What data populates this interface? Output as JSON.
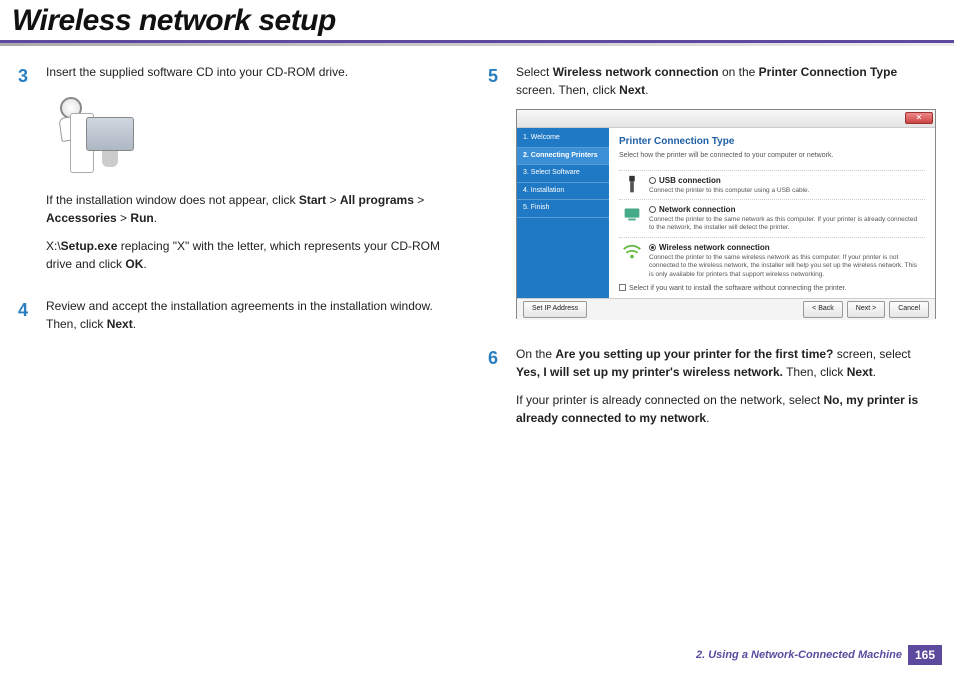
{
  "header": {
    "title": "Wireless network setup"
  },
  "left": {
    "step3": {
      "num": "3",
      "p1": "Insert the supplied software CD into your CD-ROM drive.",
      "p2a": "If the installation window does not appear, click ",
      "start": "Start",
      "gt1": " > ",
      "allprograms": "All programs",
      "gt2": " > ",
      "accessories": "Accessories",
      "gt3": " > ",
      "run": "Run",
      "p2b": ".",
      "p3a": " X:\\",
      "setup": "Setup.exe",
      "p3b": " replacing \"X\" with the letter, which represents your CD-ROM drive and click ",
      "ok": "OK",
      "p3c": "."
    },
    "step4": {
      "num": "4",
      "p1a": "Review and accept the installation agreements in the installation window. Then, click ",
      "next": "Next",
      "p1b": "."
    }
  },
  "right": {
    "step5": {
      "num": "5",
      "p1a": "Select ",
      "wnc": "Wireless network connection",
      "p1b": " on the ",
      "pct": "Printer Connection Type",
      "p1c": " screen. Then, click ",
      "next": "Next",
      "p1d": "."
    },
    "step6": {
      "num": "6",
      "p1a": "On the ",
      "q": "Are you setting up your printer for the first time?",
      "p1b": " screen, select ",
      "yes": "Yes, I will set up my printer's wireless network.",
      "p1c": " Then, click ",
      "next": "Next",
      "p1d": ".",
      "p2a": "If your printer is already connected on the network, select ",
      "no": "No, my printer is already connected to my network",
      "p2b": "."
    }
  },
  "wizard": {
    "sidebar": [
      "1. Welcome",
      "2. Connecting Printers",
      "3. Select Software",
      "4. Installation",
      "5. Finish"
    ],
    "heading": "Printer Connection Type",
    "sub": "Select how the printer will be connected to your computer or network.",
    "opt1": {
      "title": "USB connection",
      "desc": "Connect the printer to this computer using a USB cable."
    },
    "opt2": {
      "title": "Network connection",
      "desc": "Connect the printer to the same network as this computer. If your printer is already connected to the network, the installer will detect the printer."
    },
    "opt3": {
      "title": "Wireless network connection",
      "desc": "Connect the printer to the same wireless network as this computer. If your printer is not connected to the wireless network, the installer will help you set up the wireless network. This is only available for printers that support wireless networking."
    },
    "check": "Select if you want to install the software without connecting the printer.",
    "btn_ip": "Set IP Address",
    "btn_back": "< Back",
    "btn_next": "Next >",
    "btn_cancel": "Cancel"
  },
  "footer": {
    "chapter": "2.  Using a Network-Connected Machine",
    "page": "165"
  }
}
